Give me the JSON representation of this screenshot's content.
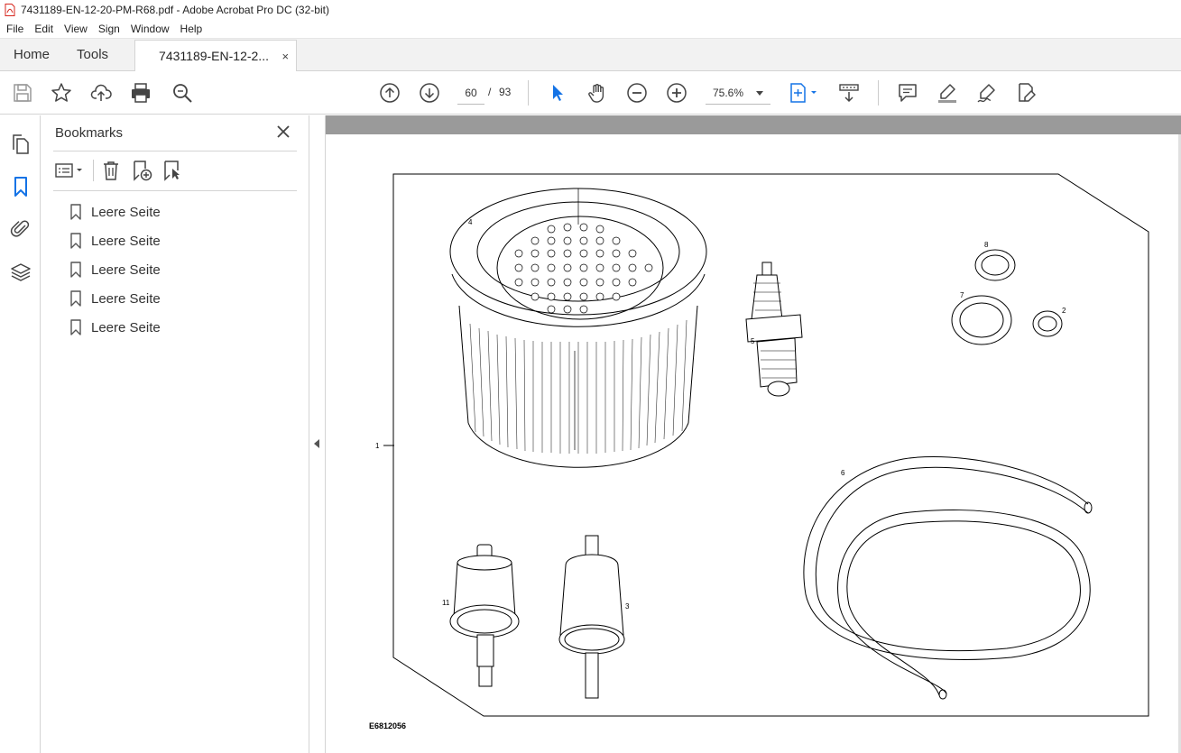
{
  "titlebar": {
    "title": "7431189-EN-12-20-PM-R68.pdf - Adobe Acrobat Pro DC (32-bit)"
  },
  "menu": {
    "items": [
      "File",
      "Edit",
      "View",
      "Sign",
      "Window",
      "Help"
    ]
  },
  "tabs": {
    "home": "Home",
    "tools": "Tools",
    "document": "7431189-EN-12-2...",
    "close_glyph": "×"
  },
  "toolbar": {
    "current_page": "60",
    "page_separator": "/",
    "total_pages": "93",
    "zoom": "75.6%"
  },
  "bookmarks": {
    "title": "Bookmarks",
    "items": [
      "Leere Seite",
      "Leere Seite",
      "Leere Seite",
      "Leere Seite",
      "Leere Seite"
    ]
  },
  "figure": {
    "callouts": [
      "1",
      "2",
      "3",
      "4",
      "5",
      "6",
      "7",
      "8",
      "11"
    ],
    "code": "E6812056"
  },
  "colors": {
    "accent": "#1473e6",
    "gray_band": "#9a9a9a",
    "pdf_red": "#d7261d"
  },
  "icons": {
    "toolbar": [
      "save-icon",
      "bookmark-star-icon",
      "cloud-upload-icon",
      "print-icon",
      "search-zoom-icon",
      "page-up-icon",
      "page-down-icon",
      "select-cursor-icon",
      "hand-icon",
      "zoom-out-icon",
      "zoom-in-icon",
      "fit-page-icon",
      "scroll-mode-icon",
      "comment-icon",
      "highlight-icon",
      "sign-icon",
      "fill-sign-icon"
    ],
    "rail": [
      "page-thumbnails-icon",
      "bookmarks-icon",
      "attachments-icon",
      "layers-icon"
    ]
  }
}
